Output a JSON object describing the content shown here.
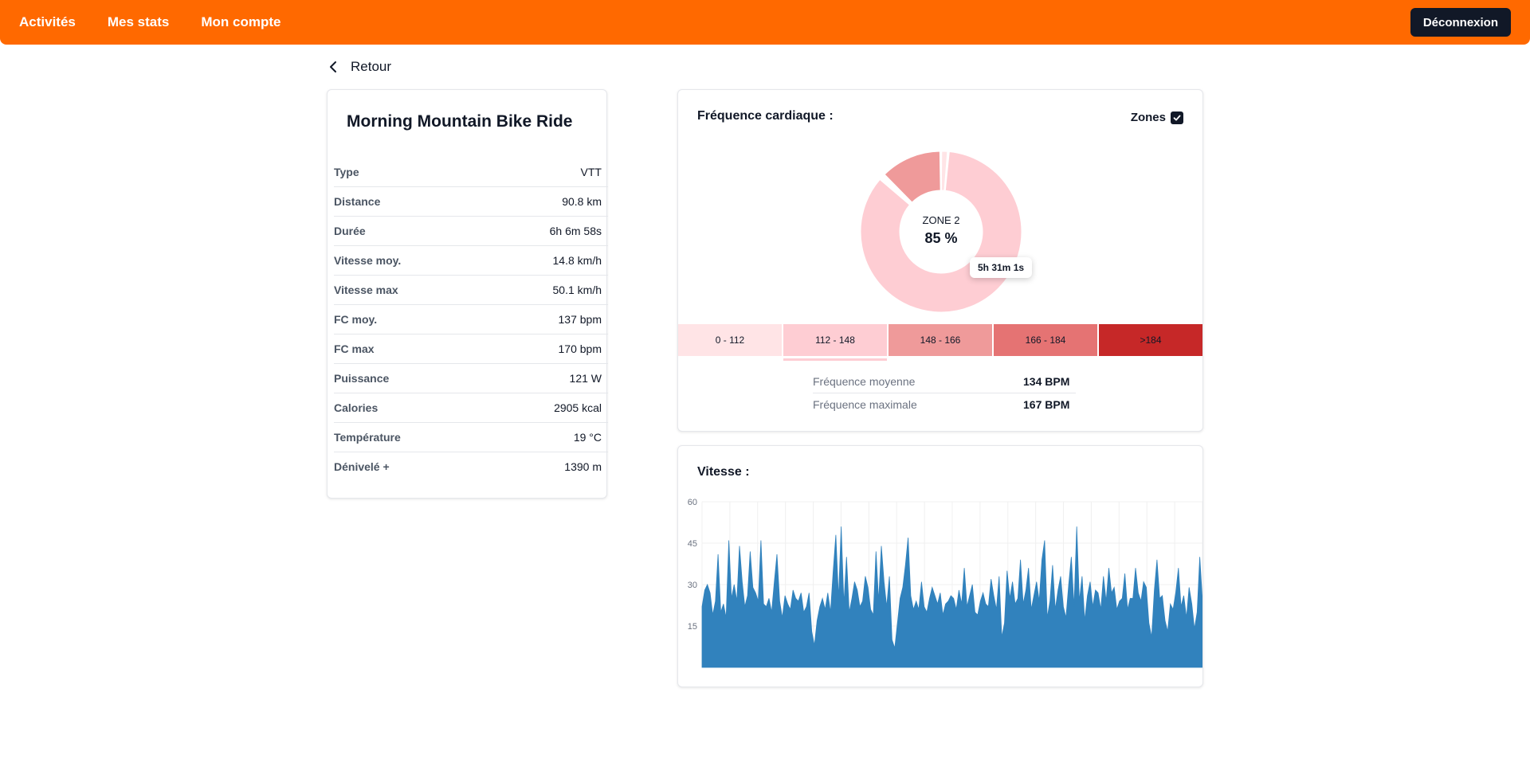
{
  "nav": {
    "links": [
      "Activités",
      "Mes stats",
      "Mon compte"
    ],
    "logout_label": "Déconnexion"
  },
  "back": {
    "label": "Retour"
  },
  "activity": {
    "title": "Morning Mountain Bike Ride",
    "rows": [
      {
        "label": "Type",
        "value": "VTT"
      },
      {
        "label": "Distance",
        "value": "90.8 km"
      },
      {
        "label": "Durée",
        "value": "6h 6m 58s"
      },
      {
        "label": "Vitesse moy.",
        "value": "14.8 km/h"
      },
      {
        "label": "Vitesse max",
        "value": "50.1 km/h"
      },
      {
        "label": "FC moy.",
        "value": "137 bpm"
      },
      {
        "label": "FC max",
        "value": "170 bpm"
      },
      {
        "label": "Puissance",
        "value": "121 W"
      },
      {
        "label": "Calories",
        "value": "2905 kcal"
      },
      {
        "label": "Température",
        "value": "19 °C"
      },
      {
        "label": "Dénivelé +",
        "value": "1390 m"
      }
    ]
  },
  "heart_rate": {
    "title": "Fréquence cardiaque :",
    "zones_toggle_label": "Zones",
    "zones_checked": true,
    "center_label": "ZONE 2",
    "center_value": "85 %",
    "tooltip": "5h 31m 1s",
    "zones": [
      {
        "label": "0 - 112",
        "color": "#ffe4e6",
        "share": 0.015
      },
      {
        "label": "112 - 148",
        "color": "#fecdd3",
        "share": 0.85
      },
      {
        "label": "148 - 166",
        "color": "#ef9a9a",
        "share": 0.125
      },
      {
        "label": "166 - 184",
        "color": "#e57373",
        "share": 0.005
      },
      {
        "label": ">184",
        "color": "#c62828",
        "share": 0.005
      }
    ],
    "selected_zone": 1,
    "stats": [
      {
        "label": "Fréquence moyenne",
        "value": "134 BPM"
      },
      {
        "label": "Fréquence maximale",
        "value": "167 BPM"
      }
    ]
  },
  "speed": {
    "title": "Vitesse :"
  },
  "chart_data": {
    "type": "area",
    "title": "Vitesse :",
    "xlabel": "",
    "ylabel": "",
    "ylim": [
      0,
      60
    ],
    "yticks": [
      15,
      30,
      45,
      60
    ],
    "grid": true,
    "color": "#3182bd",
    "series": [
      {
        "values": [
          22,
          28,
          30,
          27,
          19,
          24,
          41,
          20,
          23,
          18,
          46,
          25,
          30,
          24,
          44,
          31,
          22,
          26,
          42,
          29,
          27,
          24,
          46,
          23,
          22,
          25,
          20,
          31,
          41,
          24,
          18,
          26,
          23,
          21,
          28,
          25,
          24,
          27,
          20,
          22,
          27,
          13,
          8,
          17,
          22,
          25,
          21,
          27,
          20,
          35,
          48,
          25,
          51,
          23,
          40,
          20,
          25,
          31,
          28,
          22,
          24,
          33,
          29,
          21,
          19,
          42,
          24,
          44,
          31,
          22,
          33,
          10,
          7,
          16,
          25,
          29,
          37,
          47,
          26,
          21,
          24,
          21,
          31,
          22,
          20,
          25,
          29,
          26,
          23,
          27,
          19,
          23,
          24,
          26,
          25,
          21,
          28,
          23,
          36,
          22,
          26,
          30,
          20,
          19,
          24,
          27,
          23,
          22,
          32,
          26,
          21,
          33,
          11,
          16,
          35,
          25,
          31,
          23,
          25,
          39,
          23,
          28,
          36,
          21,
          26,
          31,
          24,
          39,
          46,
          18,
          24,
          37,
          21,
          28,
          33,
          22,
          18,
          30,
          40,
          22,
          51,
          24,
          33,
          17,
          26,
          31,
          22,
          28,
          27,
          21,
          33,
          24,
          36,
          27,
          29,
          21,
          24,
          25,
          34,
          21,
          25,
          25,
          36,
          27,
          24,
          31,
          29,
          16,
          11,
          28,
          39,
          25,
          26,
          17,
          13,
          23,
          21,
          27,
          36,
          22,
          26,
          18,
          29,
          23,
          14,
          20,
          40,
          24
        ]
      }
    ]
  }
}
